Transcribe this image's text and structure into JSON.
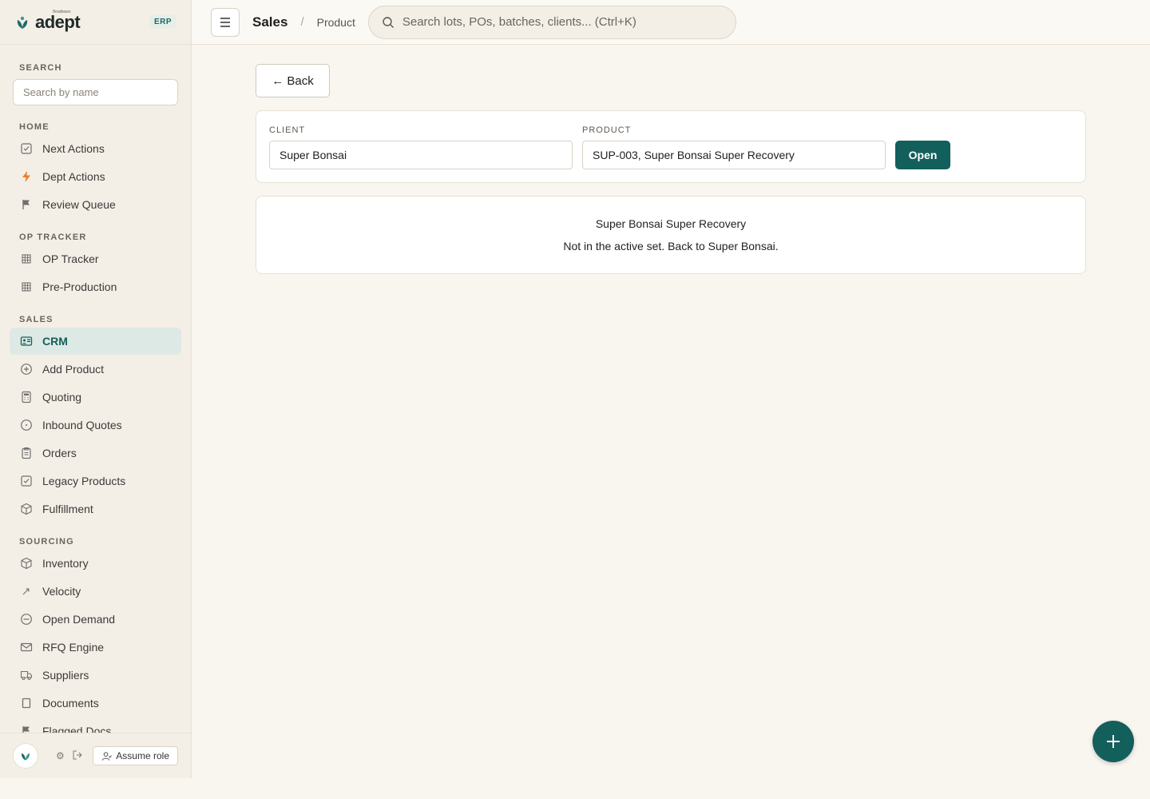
{
  "brand": {
    "name": "adept",
    "tagline": "Broadleaves",
    "badge": "ERP"
  },
  "sidebar": {
    "search_label": "SEARCH",
    "search_placeholder": "Search by name",
    "sections": [
      {
        "label": "HOME",
        "items": [
          {
            "label": "Next Actions",
            "icon": "checkbox-icon"
          },
          {
            "label": "Dept Actions",
            "icon": "lightning-icon"
          },
          {
            "label": "Review Queue",
            "icon": "flag-icon"
          }
        ]
      },
      {
        "label": "OP TRACKER",
        "items": [
          {
            "label": "OP Tracker",
            "icon": "grid-icon"
          },
          {
            "label": "Pre-Production",
            "icon": "grid-icon"
          }
        ]
      },
      {
        "label": "SALES",
        "items": [
          {
            "label": "CRM",
            "icon": "contact-card-icon",
            "active": true
          },
          {
            "label": "Add Product",
            "icon": "plus-circle-icon"
          },
          {
            "label": "Quoting",
            "icon": "calculator-icon"
          },
          {
            "label": "Inbound Quotes",
            "icon": "clock-icon"
          },
          {
            "label": "Orders",
            "icon": "clipboard-icon"
          },
          {
            "label": "Legacy Products",
            "icon": "checkbox-icon"
          },
          {
            "label": "Fulfillment",
            "icon": "package-icon"
          }
        ]
      },
      {
        "label": "SOURCING",
        "items": [
          {
            "label": "Inventory",
            "icon": "box-icon"
          },
          {
            "label": "Velocity",
            "icon": "trend-icon"
          },
          {
            "label": "Open Demand",
            "icon": "minus-circle-icon"
          },
          {
            "label": "RFQ Engine",
            "icon": "mail-icon"
          },
          {
            "label": "Suppliers",
            "icon": "truck-icon"
          },
          {
            "label": "Documents",
            "icon": "document-icon"
          },
          {
            "label": "Flagged Docs",
            "icon": "flag-icon"
          }
        ]
      }
    ],
    "footer": {
      "assume_role_label": "Assume role"
    }
  },
  "topbar": {
    "breadcrumb_main": "Sales",
    "breadcrumb_sep": "/",
    "breadcrumb_sub": "Product",
    "search_placeholder": "Search lots, POs, batches, clients...  (Ctrl+K)"
  },
  "main": {
    "back_label": "← Back",
    "client_label": "CLIENT",
    "client_value": "Super Bonsai",
    "product_label": "PRODUCT",
    "product_value": "SUP-003, Super Bonsai Super Recovery",
    "open_label": "Open",
    "result_title": "Super Bonsai Super Recovery",
    "result_message": "Not in the active set. Back to Super Bonsai."
  },
  "colors": {
    "accent": "#135f5c",
    "sidebar_bg": "#f4efe6",
    "page_bg": "#f9f6f0"
  }
}
